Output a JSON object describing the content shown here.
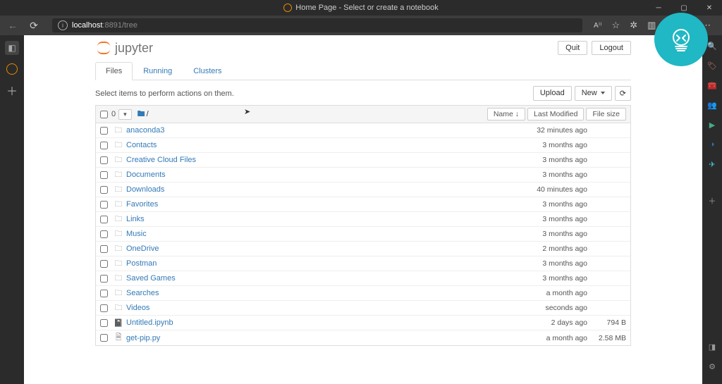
{
  "window": {
    "title": "Home Page - Select or create a notebook"
  },
  "browser": {
    "url_host": "localhost",
    "url_port_path": ":8891/tree"
  },
  "jupyter": {
    "logo_text": "jupyter",
    "quit_label": "Quit",
    "logout_label": "Logout",
    "tabs": {
      "files": "Files",
      "running": "Running",
      "clusters": "Clusters"
    },
    "select_hint": "Select items to perform actions on them.",
    "upload_label": "Upload",
    "new_label": "New",
    "selected_count": "0",
    "breadcrumb_root": "/",
    "sort_name": "Name",
    "sort_modified": "Last Modified",
    "sort_size": "File size"
  },
  "files": [
    {
      "type": "folder",
      "name": "anaconda3",
      "modified": "32 minutes ago",
      "size": ""
    },
    {
      "type": "folder",
      "name": "Contacts",
      "modified": "3 months ago",
      "size": ""
    },
    {
      "type": "folder",
      "name": "Creative Cloud Files",
      "modified": "3 months ago",
      "size": ""
    },
    {
      "type": "folder",
      "name": "Documents",
      "modified": "3 months ago",
      "size": ""
    },
    {
      "type": "folder",
      "name": "Downloads",
      "modified": "40 minutes ago",
      "size": ""
    },
    {
      "type": "folder",
      "name": "Favorites",
      "modified": "3 months ago",
      "size": ""
    },
    {
      "type": "folder",
      "name": "Links",
      "modified": "3 months ago",
      "size": ""
    },
    {
      "type": "folder",
      "name": "Music",
      "modified": "3 months ago",
      "size": ""
    },
    {
      "type": "folder",
      "name": "OneDrive",
      "modified": "2 months ago",
      "size": ""
    },
    {
      "type": "folder",
      "name": "Postman",
      "modified": "3 months ago",
      "size": ""
    },
    {
      "type": "folder",
      "name": "Saved Games",
      "modified": "3 months ago",
      "size": ""
    },
    {
      "type": "folder",
      "name": "Searches",
      "modified": "a month ago",
      "size": ""
    },
    {
      "type": "folder",
      "name": "Videos",
      "modified": "seconds ago",
      "size": ""
    },
    {
      "type": "notebook",
      "name": "Untitled.ipynb",
      "modified": "2 days ago",
      "size": "794 B"
    },
    {
      "type": "file",
      "name": "get-pip.py",
      "modified": "a month ago",
      "size": "2.58 MB"
    }
  ]
}
